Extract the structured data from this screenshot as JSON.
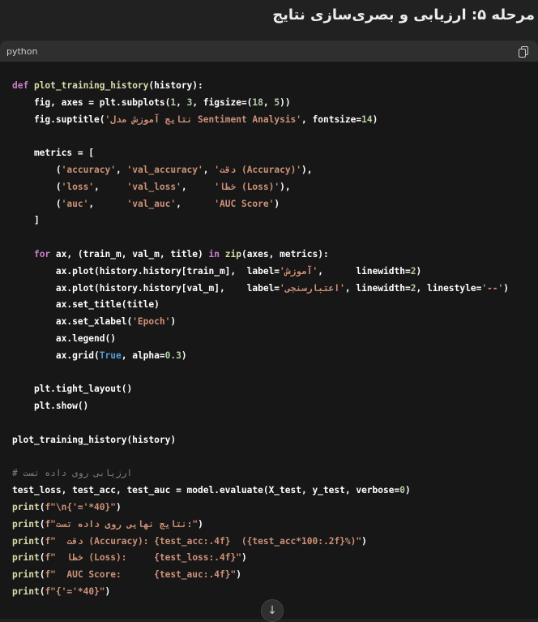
{
  "heading": "مرحله ۵: ارزیابی و بصری‌سازی نتایج",
  "code_header": {
    "language": "python",
    "copy_icon": "copy-icon"
  },
  "colors": {
    "keyword": "#cc7dcb",
    "function": "#dcdcaa",
    "string": "#ce9178",
    "number": "#b5cea8",
    "comment": "#808080",
    "boolean": "#569cd6"
  },
  "code_lines": [
    [
      {
        "t": "def ",
        "c": "kw"
      },
      {
        "t": "plot_training_history",
        "c": "fn"
      },
      {
        "t": "(history):"
      }
    ],
    [
      {
        "t": "    fig, axes = plt.subplots("
      },
      {
        "t": "1",
        "c": "num"
      },
      {
        "t": ", "
      },
      {
        "t": "3",
        "c": "num"
      },
      {
        "t": ", figsize=("
      },
      {
        "t": "18",
        "c": "num"
      },
      {
        "t": ", "
      },
      {
        "t": "5",
        "c": "num"
      },
      {
        "t": "))"
      }
    ],
    [
      {
        "t": "    fig.suptitle("
      },
      {
        "t": "'نتایج آموزش مدل Sentiment Analysis'",
        "c": "str"
      },
      {
        "t": ", fontsize="
      },
      {
        "t": "14",
        "c": "num"
      },
      {
        "t": ")"
      }
    ],
    [],
    [
      {
        "t": "    metrics = ["
      }
    ],
    [
      {
        "t": "        ("
      },
      {
        "t": "'accuracy'",
        "c": "str"
      },
      {
        "t": ", "
      },
      {
        "t": "'val_accuracy'",
        "c": "str"
      },
      {
        "t": ", "
      },
      {
        "t": "'دقت (Accuracy)'",
        "c": "str"
      },
      {
        "t": "),"
      }
    ],
    [
      {
        "t": "        ("
      },
      {
        "t": "'loss'",
        "c": "str"
      },
      {
        "t": ",     "
      },
      {
        "t": "'val_loss'",
        "c": "str"
      },
      {
        "t": ",     "
      },
      {
        "t": "'خطا (Loss)'",
        "c": "str"
      },
      {
        "t": "),"
      }
    ],
    [
      {
        "t": "        ("
      },
      {
        "t": "'auc'",
        "c": "str"
      },
      {
        "t": ",      "
      },
      {
        "t": "'val_auc'",
        "c": "str"
      },
      {
        "t": ",      "
      },
      {
        "t": "'AUC Score'",
        "c": "str"
      },
      {
        "t": ")"
      }
    ],
    [
      {
        "t": "    ]"
      }
    ],
    [],
    [
      {
        "t": "    "
      },
      {
        "t": "for",
        "c": "kw"
      },
      {
        "t": " ax, (train_m, val_m, title) "
      },
      {
        "t": "in",
        "c": "kw"
      },
      {
        "t": " "
      },
      {
        "t": "zip",
        "c": "bi"
      },
      {
        "t": "(axes, metrics):"
      }
    ],
    [
      {
        "t": "        ax.plot(history.history[train_m],  label="
      },
      {
        "t": "'آموزش'",
        "c": "str"
      },
      {
        "t": ",      linewidth="
      },
      {
        "t": "2",
        "c": "num"
      },
      {
        "t": ")"
      }
    ],
    [
      {
        "t": "        ax.plot(history.history[val_m],    label="
      },
      {
        "t": "'اعتبارسنجی'",
        "c": "str"
      },
      {
        "t": ", linewidth="
      },
      {
        "t": "2",
        "c": "num"
      },
      {
        "t": ", linestyle="
      },
      {
        "t": "'--'",
        "c": "str"
      },
      {
        "t": ")"
      }
    ],
    [
      {
        "t": "        ax.set_title(title)"
      }
    ],
    [
      {
        "t": "        ax.set_xlabel("
      },
      {
        "t": "'Epoch'",
        "c": "str"
      },
      {
        "t": ")"
      }
    ],
    [
      {
        "t": "        ax.legend()"
      }
    ],
    [
      {
        "t": "        ax.grid("
      },
      {
        "t": "True",
        "c": "tf"
      },
      {
        "t": ", alpha="
      },
      {
        "t": "0.3",
        "c": "num"
      },
      {
        "t": ")"
      }
    ],
    [],
    [
      {
        "t": "    plt.tight_layout()"
      }
    ],
    [
      {
        "t": "    plt.show()"
      }
    ],
    [],
    [
      {
        "t": "plot_training_history(history)"
      }
    ],
    [],
    [
      {
        "t": "# ارزیابی روی داده تست",
        "c": "com"
      }
    ],
    [
      {
        "t": "test_loss, test_acc, test_auc = model.evaluate(X_test, y_test, verbose="
      },
      {
        "t": "0",
        "c": "num"
      },
      {
        "t": ")"
      }
    ],
    [
      {
        "t": "print",
        "c": "bi"
      },
      {
        "t": "("
      },
      {
        "t": "f\"\\n{'='*40}\"",
        "c": "str"
      },
      {
        "t": ")"
      }
    ],
    [
      {
        "t": "print",
        "c": "bi"
      },
      {
        "t": "("
      },
      {
        "t": "f\"نتایج نهایی روی داده تست:\"",
        "c": "str"
      },
      {
        "t": ")"
      }
    ],
    [
      {
        "t": "print",
        "c": "bi"
      },
      {
        "t": "("
      },
      {
        "t": "f\"  دقت (Accuracy): {test_acc:.4f}  ({test_acc*100:.2f}%)\"",
        "c": "str"
      },
      {
        "t": ")"
      }
    ],
    [
      {
        "t": "print",
        "c": "bi"
      },
      {
        "t": "("
      },
      {
        "t": "f\"  خطا (Loss):     {test_loss:.4f}\"",
        "c": "str"
      },
      {
        "t": ")"
      }
    ],
    [
      {
        "t": "print",
        "c": "bi"
      },
      {
        "t": "("
      },
      {
        "t": "f\"  AUC Score:      {test_auc:.4f}\"",
        "c": "str"
      },
      {
        "t": ")"
      }
    ],
    [
      {
        "t": "print",
        "c": "bi"
      },
      {
        "t": "("
      },
      {
        "t": "f\"{'='*40}\"",
        "c": "str"
      },
      {
        "t": ")"
      }
    ]
  ],
  "scroll_button": {
    "icon": "arrow-down-icon",
    "glyph": "↓"
  }
}
